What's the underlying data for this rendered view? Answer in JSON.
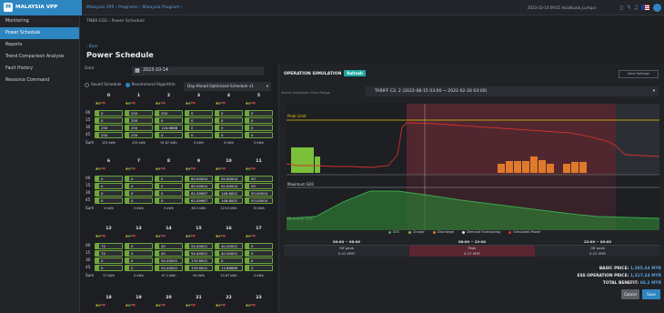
{
  "app": {
    "name": "MALAYSIA VPP",
    "logo_letter": "M"
  },
  "top": {
    "breadcrumb": "Malaysia VPP  ›  Programs  ›  Malaysia Program  ›",
    "datetime": "2023-10-14 09:02 Asia/Kuala_Lumpur"
  },
  "sidebar": {
    "items": [
      {
        "label": "Monitoring"
      },
      {
        "label": "Power Schedule"
      },
      {
        "label": "Reports"
      },
      {
        "label": "Trend Comparison Analysis"
      },
      {
        "label": "Fault History"
      },
      {
        "label": "Resource Command"
      }
    ]
  },
  "page": {
    "crumb": "TNBR ESS  ›  Power Schedule",
    "back": "‹ Back",
    "title": "Power Schedule",
    "date_label": "Date",
    "date_value": "2023-10-14",
    "saved_label": "Saved Schedule",
    "rec_label": "Recommend Algorithm",
    "algo_value": "Day-Ahead Optimized Schedule v1"
  },
  "rows": [
    "00",
    "15",
    "30",
    "45",
    "Sum"
  ],
  "blocks": [
    {
      "hours": [
        "0",
        "1",
        "2",
        "3",
        "4",
        "5"
      ],
      "cells": [
        [
          "0",
          "250",
          "250",
          "0",
          "0",
          "0"
        ],
        [
          "0",
          "250",
          "0",
          "0",
          "0",
          "0"
        ],
        [
          "250",
          "250",
          "116.6666",
          "0",
          "0",
          "0"
        ],
        [
          "250",
          "250",
          "0",
          "0",
          "0",
          "0"
        ]
      ],
      "sums": [
        "125 kWh",
        "225 kWh",
        "91.67 kWh",
        "0 kWh",
        "0 kWh",
        "0 kWh"
      ]
    },
    {
      "hours": [
        "6",
        "7",
        "8",
        "9",
        "10",
        "11"
      ],
      "cells": [
        [
          "0",
          "0",
          "0",
          "60.00004",
          "92.60004",
          "93"
        ],
        [
          "0",
          "0",
          "0",
          "60.00004",
          "92.60004",
          "93"
        ],
        [
          "0",
          "0",
          "0",
          "61.09987",
          "148.6001",
          "93.00004"
        ],
        [
          "0",
          "0",
          "0",
          "61.09987",
          "148.6001",
          "93.00004"
        ]
      ],
      "sums": [
        "0 kWh",
        "0 kWh",
        "0 kWh",
        "60.5 kWh",
        "119.5 kWh",
        "70 kWh"
      ]
    },
    {
      "hours": [
        "12",
        "13",
        "14",
        "15",
        "16",
        "17"
      ],
      "cells": [
        [
          "74",
          "0",
          "40",
          "54.40001",
          "40.40001",
          "0"
        ],
        [
          "74",
          "0",
          "40",
          "54.40001",
          "40.40001",
          "0"
        ],
        [
          "0",
          "0",
          "54.40001",
          "133.6001",
          "0",
          "0"
        ],
        [
          "0",
          "0",
          "54.40001",
          "133.6001",
          "13.86666",
          "0"
        ]
      ],
      "sums": [
        "37 kWh",
        "0 kWh",
        "47.2 kWh",
        "94 kWh",
        "23.67 kWh",
        "0 kWh"
      ]
    },
    {
      "hours": [
        "18",
        "19",
        "20",
        "21",
        "22",
        "23"
      ]
    }
  ],
  "simulation": {
    "title": "OPERATION SIMULATION",
    "refresh": "Refresh",
    "view_settings": "View Settings",
    "price_label": "Select Simulation Price Range",
    "tariff": "TARIFF C2, 2 (2022-08-15 03:00 ~ 2022-02-20 03:00)",
    "peak_label": "Peak Limit",
    "max_soc": "Maximum SOC",
    "min_soc": "Minimum SOC",
    "legend": [
      "SOC",
      "Charge",
      "Discharge",
      "Demand Forecasting",
      "Simulated Power"
    ],
    "colors": {
      "soc": "#3da94a",
      "charge": "#7bbf3a",
      "discharge": "#e07a2a",
      "forecast": "#e8eaed",
      "sim": "#d0312d",
      "peak": "#e3c500",
      "band": "#7a2d3a"
    }
  },
  "periods": [
    {
      "time": "00:00 ~ 08:00",
      "type": "Off peak",
      "price": "0.22 MYR"
    },
    {
      "time": "08:00 ~ 22:00",
      "type": "Peak",
      "price": "0.37 MYR"
    },
    {
      "time": "22:00 ~ 00:00",
      "type": "Off peak",
      "price": "0.22 MYR"
    }
  ],
  "totals": {
    "basic_label": "BASIC PRICE:",
    "basic": "1,385.44 MYR",
    "ess_label": "ESS OPERATION PRICE:",
    "ess": "1,317.24 MYR",
    "benefit_label": "TOTAL BENEFIT:",
    "benefit": "68.2 MYR"
  },
  "buttons": {
    "cancel": "Cancel",
    "save": "Save"
  }
}
